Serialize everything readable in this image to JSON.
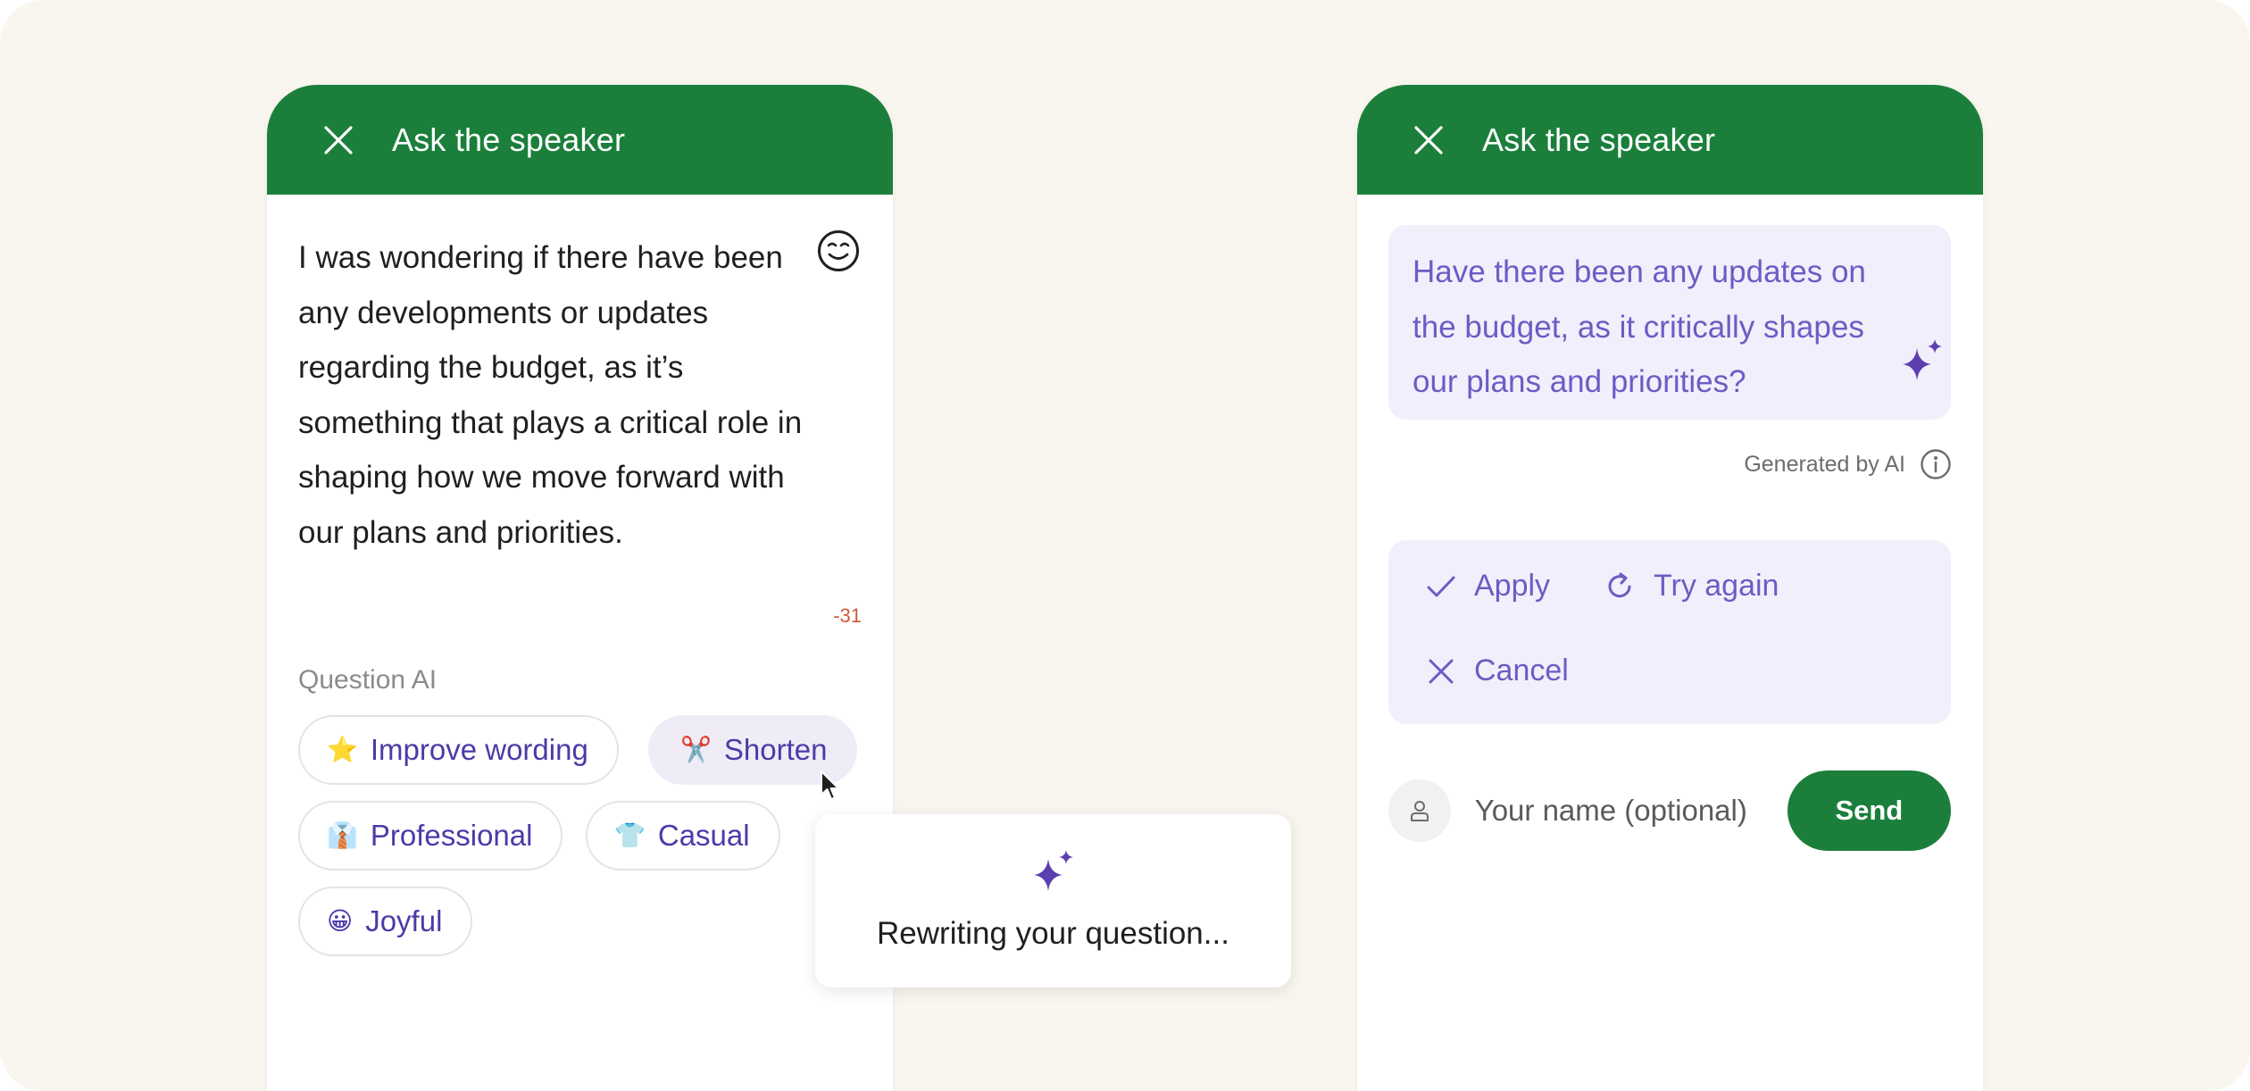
{
  "left_panel": {
    "title": "Ask the speaker",
    "question_text": "I was wondering if there have been any developments or updates regarding the budget, as it’s something that plays a critical role in shaping how we move forward with our plans and priorities.",
    "char_count": "-31",
    "ai_label": "Question AI",
    "chips": [
      {
        "icon": "⭐",
        "label": "Improve wording"
      },
      {
        "icon": "✂️",
        "label": "Shorten"
      },
      {
        "icon": "👔",
        "label": "Professional"
      },
      {
        "icon": "👕",
        "label": "Casual"
      },
      {
        "icon": "😀",
        "label": "Joyful"
      }
    ]
  },
  "popover": {
    "text": "Rewriting your question..."
  },
  "right_panel": {
    "title": "Ask the speaker",
    "suggestion": "Have there been any updates on the budget, as it critically shapes our plans and priorities?",
    "generated_label": "Generated by AI",
    "actions": {
      "apply": "Apply",
      "try_again": "Try again",
      "cancel": "Cancel"
    },
    "name_placeholder": "Your name (optional)",
    "send_label": "Send"
  },
  "colors": {
    "header_green": "#1b7f3b",
    "accent_purple": "#6e5bc3",
    "chip_text": "#4d3aa8",
    "suggestion_bg": "#f1effb",
    "background": "#f9f6ef"
  },
  "icons": [
    "close-icon",
    "emoji-icon",
    "sparkle-icon",
    "info-icon",
    "check-icon",
    "refresh-icon",
    "user-icon",
    "cursor-icon"
  ]
}
